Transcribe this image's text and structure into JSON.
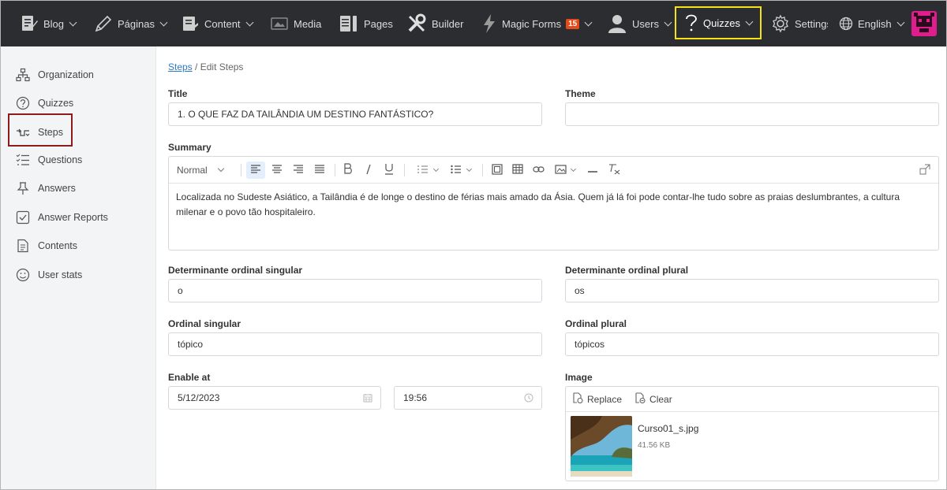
{
  "topbar": {
    "items": [
      {
        "label": "Blog",
        "icon": "blog-icon"
      },
      {
        "label": "Páginas",
        "icon": "pencil-icon"
      },
      {
        "label": "Content",
        "icon": "content-icon"
      },
      {
        "label": "Media",
        "icon": "media-icon"
      },
      {
        "label": "Pages",
        "icon": "pages-icon"
      },
      {
        "label": "Builder",
        "icon": "tools-icon"
      },
      {
        "label": "Magic Forms",
        "icon": "bolt-icon",
        "badge": "15"
      },
      {
        "label": "Users",
        "icon": "user-icon"
      },
      {
        "label": "Quizzes",
        "icon": "question-icon"
      },
      {
        "label": "Settings",
        "icon": "gear-icon"
      },
      {
        "label": "English",
        "icon": "globe-icon"
      }
    ]
  },
  "sidebar": {
    "items": [
      {
        "label": "Organization",
        "icon": "organization-icon"
      },
      {
        "label": "Quizzes",
        "icon": "question-circle-icon"
      },
      {
        "label": "Steps",
        "icon": "steps-icon"
      },
      {
        "label": "Questions",
        "icon": "list-icon"
      },
      {
        "label": "Answers",
        "icon": "pin-icon"
      },
      {
        "label": "Answer Reports",
        "icon": "check-square-icon"
      },
      {
        "label": "Contents",
        "icon": "document-icon"
      },
      {
        "label": "User stats",
        "icon": "smile-icon"
      }
    ]
  },
  "breadcrumb": {
    "link": "Steps",
    "separator": "/",
    "current": "Edit Steps"
  },
  "form": {
    "title_label": "Title",
    "title_value": "1. O QUE FAZ DA TAILÂNDIA UM DESTINO FANTÁSTICO?",
    "theme_label": "Theme",
    "theme_value": "",
    "summary_label": "Summary",
    "summary_format": "Normal",
    "summary_text": "Localizada no Sudeste Asiático, a Tailândia é de longe o destino de férias mais amado da Ásia. Quem já lá foi pode contar-lhe tudo sobre as praias deslumbrantes, a cultura milenar e o povo tão hospitaleiro.",
    "det_singular_label": "Determinante ordinal singular",
    "det_singular_value": "o",
    "det_plural_label": "Determinante ordinal plural",
    "det_plural_value": "os",
    "ord_singular_label": "Ordinal singular",
    "ord_singular_value": "tópico",
    "ord_plural_label": "Ordinal plural",
    "ord_plural_value": "tópicos",
    "enable_label": "Enable at",
    "enable_date": "5/12/2023",
    "enable_time": "19:56",
    "image_label": "Image",
    "image_replace": "Replace",
    "image_clear": "Clear",
    "image_filename": "Curso01_s.jpg",
    "image_size": "41.56 KB"
  },
  "colors": {
    "topbar": "#2b2d30",
    "highlight_yellow": "#f4e11a",
    "highlight_red": "#8e1b1b",
    "link": "#2a7bc4",
    "badge": "#e64a19",
    "avatar": "#e01d8d"
  }
}
